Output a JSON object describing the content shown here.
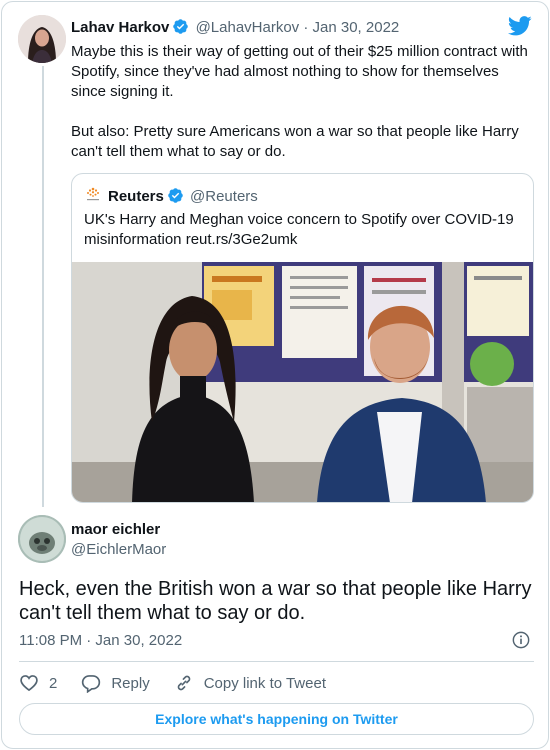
{
  "original_tweet": {
    "display_name": "Lahav Harkov",
    "handle": "@LahavHarkov",
    "separator": "·",
    "date": "Jan 30, 2022",
    "text": "Maybe this is their way of getting out of their $25 million contract with Spotify, since they've had almost nothing to show for themselves since signing it.\n\nBut also: Pretty sure Americans won a war so that people like Harry can't tell them what to say or do."
  },
  "quoted_tweet": {
    "display_name": "Reuters",
    "handle": "@Reuters",
    "text": "UK's Harry and Meghan voice concern to Spotify over COVID-19 misinformation reut.rs/3Ge2umk"
  },
  "reply_tweet": {
    "display_name": "maor eichler",
    "handle": "@EichlerMaor",
    "text": "Heck, even the British won a war so that people like Harry can't tell them what to say or do.",
    "timestamp": "11:08 PM · Jan 30, 2022"
  },
  "actions": {
    "like_count": "2",
    "reply_label": "Reply",
    "copy_link_label": "Copy link to Tweet"
  },
  "footer": {
    "explore_label": "Explore what's happening on Twitter"
  },
  "colors": {
    "twitter_blue": "#1d9bf0",
    "muted_text": "#536471",
    "border": "#cfd9de"
  },
  "icons": [
    "twitter-bird-icon",
    "verified-badge-icon",
    "reuters-logo-icon",
    "info-icon",
    "heart-icon",
    "reply-bubble-icon",
    "link-icon"
  ]
}
